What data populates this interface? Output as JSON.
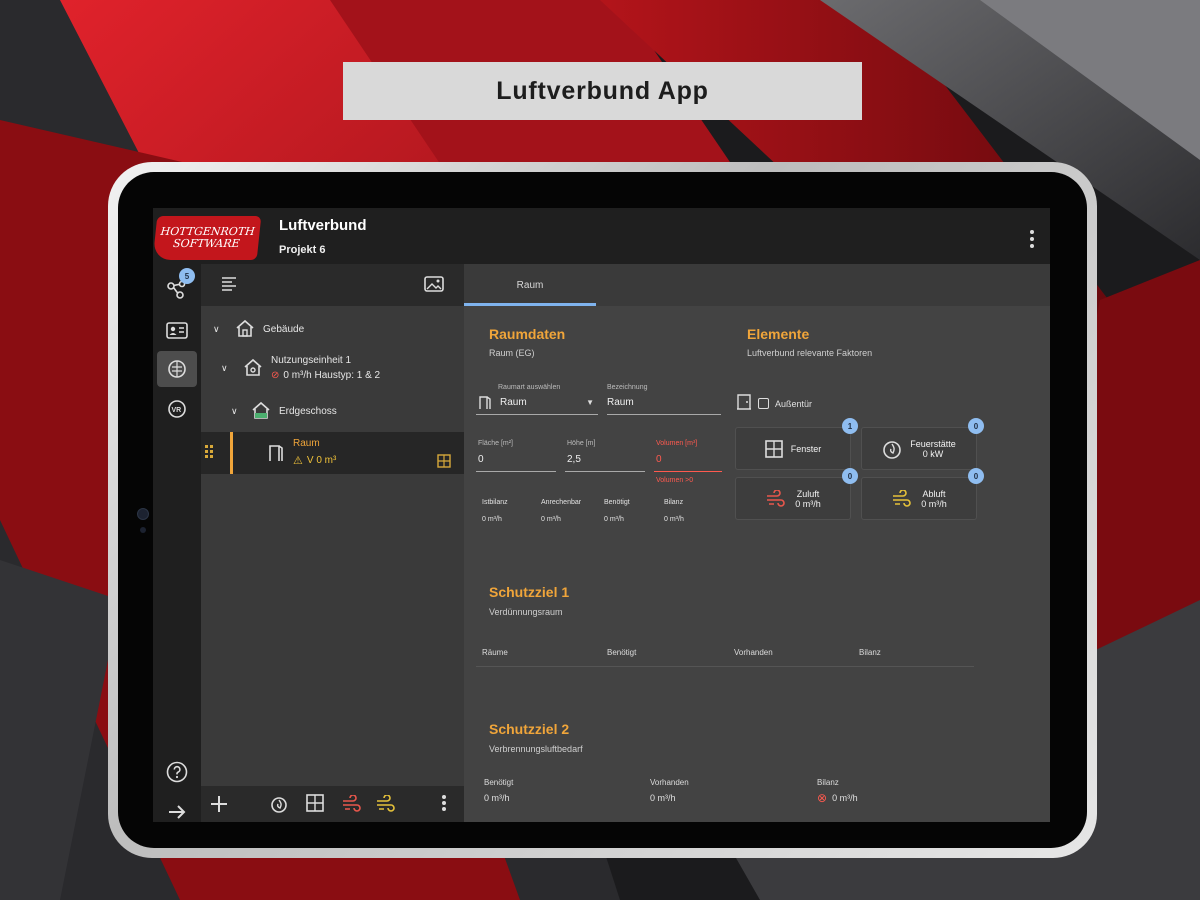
{
  "banner": {
    "title": "Luftverbund App"
  },
  "header": {
    "logo_line1": "HOTTGENROTH",
    "logo_line2": "SOFTWARE",
    "title": "Luftverbund",
    "subtitle": "Projekt 6"
  },
  "rail": {
    "badge_count": "5"
  },
  "tree": {
    "items": [
      {
        "label": "Gebäude"
      },
      {
        "label": "Nutzungseinheit 1",
        "detail": "0 m³/h Haustyp: 1 & 2"
      },
      {
        "label": "Erdgeschoss"
      },
      {
        "label": "Raum",
        "detail": "V 0 m³"
      }
    ]
  },
  "tabs": [
    {
      "label": "Raum"
    }
  ],
  "raumdaten": {
    "title": "Raumdaten",
    "subtitle": "Raum (EG)",
    "select_label": "Raumart auswählen",
    "select_value": "Raum",
    "name_label": "Bezeichnung",
    "name_value": "Raum",
    "flaeche_label": "Fläche [m²]",
    "flaeche_value": "0",
    "hoehe_label": "Höhe [m]",
    "hoehe_value": "2,5",
    "volumen_label": "Volumen [m³]",
    "volumen_value": "0",
    "volumen_error": "Volumen >0",
    "stats": [
      {
        "label": "Istbilanz",
        "value": "0 m³/h"
      },
      {
        "label": "Anrechenbar",
        "value": "0 m³/h"
      },
      {
        "label": "Benötigt",
        "value": "0 m³/h"
      },
      {
        "label": "Bilanz",
        "value": "0 m³/h"
      }
    ]
  },
  "elemente": {
    "title": "Elemente",
    "subtitle": "Luftverbund relevante Faktoren",
    "aussentuer": "Außentür",
    "cards": [
      {
        "label": "Fenster",
        "sub": "",
        "badge": "1"
      },
      {
        "label": "Feuerstätte",
        "sub": "0 kW",
        "badge": "0"
      },
      {
        "label": "Zuluft",
        "sub": "0 m³/h",
        "badge": "0"
      },
      {
        "label": "Abluft",
        "sub": "0 m³/h",
        "badge": "0"
      }
    ]
  },
  "schutzziel1": {
    "title": "Schutzziel 1",
    "subtitle": "Verdünnungsraum",
    "columns": [
      "Räume",
      "Benötigt",
      "Vorhanden",
      "Bilanz"
    ]
  },
  "schutzziel2": {
    "title": "Schutzziel 2",
    "subtitle": "Verbrennungsluftbedarf",
    "stats": [
      {
        "label": "Benötigt",
        "value": "0 m³/h"
      },
      {
        "label": "Vorhanden",
        "value": "0 m³/h"
      },
      {
        "label": "Bilanz",
        "value": "0 m³/h"
      }
    ]
  },
  "colors": {
    "accent_orange": "#f0a53a",
    "accent_blue": "#7fb3ee",
    "error_red": "#ff5a4f",
    "brand_red": "#c3161c"
  }
}
